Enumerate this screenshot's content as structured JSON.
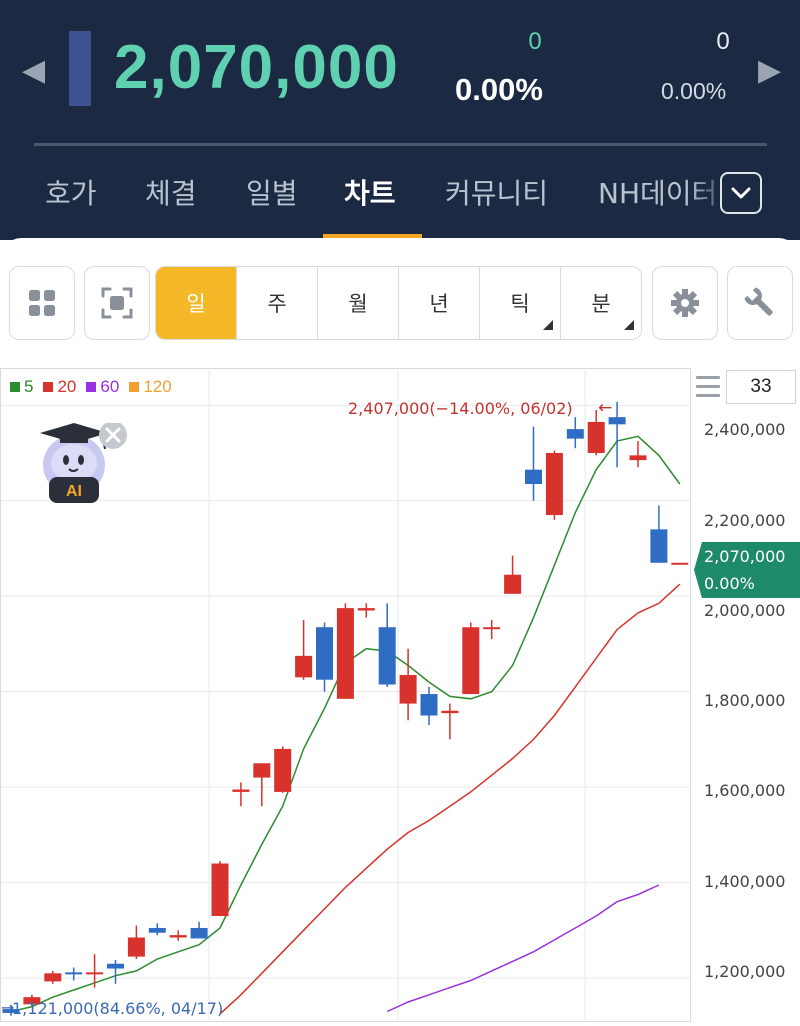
{
  "header": {
    "price": "2,070,000",
    "change_primary": "0",
    "change_primary_pct": "0.00%",
    "change_secondary": "0",
    "change_secondary_pct": "0.00%",
    "nav_left_icon": "chevron-left-icon",
    "nav_right_icon": "chevron-right-icon",
    "colors": {
      "background": "#1b2a42",
      "price": "#5fd0b0",
      "indicator": "#3f5394"
    }
  },
  "tabs": {
    "items": [
      {
        "label": "호가",
        "active": false
      },
      {
        "label": "체결",
        "active": false
      },
      {
        "label": "일별",
        "active": false
      },
      {
        "label": "차트",
        "active": true
      },
      {
        "label": "커뮤니티",
        "active": false
      },
      {
        "label": "NH데이터",
        "active": false
      }
    ],
    "more_icon": "chevron-down-icon",
    "accent": "#f5a524"
  },
  "toolbar": {
    "layout_icon": "grid-icon",
    "capture_icon": "screenshot-icon",
    "periods": [
      {
        "label": "일",
        "active": true,
        "has_dropdown": false
      },
      {
        "label": "주",
        "active": false,
        "has_dropdown": false
      },
      {
        "label": "월",
        "active": false,
        "has_dropdown": false
      },
      {
        "label": "년",
        "active": false,
        "has_dropdown": false
      },
      {
        "label": "틱",
        "active": false,
        "has_dropdown": true
      },
      {
        "label": "분",
        "active": false,
        "has_dropdown": true
      }
    ],
    "settings_icon": "gear-icon",
    "tools_icon": "wrench-icon",
    "active_color": "#f5b829"
  },
  "chart_panel": {
    "period_count": "33",
    "menu_icon": "hamburger-icon",
    "ai_badge": {
      "label": "AI",
      "close_icon": "close-icon"
    },
    "current_price": "2,070,000",
    "current_pct": "0.00%",
    "high_label": "2,407,000(−14.00%, 06/02)",
    "low_label": "1,121,000(84.66%, 04/17)"
  },
  "chart_data": {
    "type": "candlestick",
    "legend": [
      {
        "name": "5",
        "color": "#2e8b2e"
      },
      {
        "name": "20",
        "color": "#d8322c"
      },
      {
        "name": "60",
        "color": "#9b30e0"
      },
      {
        "name": "120",
        "color": "#f0a030"
      }
    ],
    "y_ticks": [
      "2,400,000",
      "2,200,000",
      "2,000,000",
      "1,800,000",
      "1,600,000",
      "1,400,000",
      "1,200,000"
    ],
    "y_tick_values": [
      2400000,
      2200000,
      2000000,
      1800000,
      1600000,
      1400000,
      1200000
    ],
    "ylim": [
      1108000,
      2478000
    ],
    "grid": true,
    "up_color": "#d8322c",
    "down_color": "#2f6cc4",
    "candles": [
      {
        "open": 1135000,
        "high": 1143000,
        "low": 1121000,
        "close": 1127000
      },
      {
        "open": 1145000,
        "high": 1165000,
        "low": 1140000,
        "close": 1160000
      },
      {
        "open": 1193000,
        "high": 1215000,
        "low": 1188000,
        "close": 1210000
      },
      {
        "open": 1212000,
        "high": 1222000,
        "low": 1195000,
        "close": 1208000
      },
      {
        "open": 1208000,
        "high": 1250000,
        "low": 1180000,
        "close": 1212000
      },
      {
        "open": 1230000,
        "high": 1238000,
        "low": 1188000,
        "close": 1220000
      },
      {
        "open": 1245000,
        "high": 1310000,
        "low": 1240000,
        "close": 1285000
      },
      {
        "open": 1305000,
        "high": 1315000,
        "low": 1290000,
        "close": 1295000
      },
      {
        "open": 1285000,
        "high": 1300000,
        "low": 1278000,
        "close": 1290000
      },
      {
        "open": 1305000,
        "high": 1318000,
        "low": 1285000,
        "close": 1283000
      },
      {
        "open": 1330000,
        "high": 1445000,
        "low": 1330000,
        "close": 1440000
      },
      {
        "open": 1590000,
        "high": 1610000,
        "low": 1560000,
        "close": 1595000
      },
      {
        "open": 1620000,
        "high": 1650000,
        "low": 1560000,
        "close": 1650000
      },
      {
        "open": 1590000,
        "high": 1685000,
        "low": 1588000,
        "close": 1680000
      },
      {
        "open": 1830000,
        "high": 1950000,
        "low": 1825000,
        "close": 1875000
      },
      {
        "open": 1935000,
        "high": 1945000,
        "low": 1800000,
        "close": 1825000
      },
      {
        "open": 1785000,
        "high": 1985000,
        "low": 1785000,
        "close": 1975000
      },
      {
        "open": 1970000,
        "high": 1985000,
        "low": 1955000,
        "close": 1975000
      },
      {
        "open": 1935000,
        "high": 1985000,
        "low": 1810000,
        "close": 1815000
      },
      {
        "open": 1775000,
        "high": 1890000,
        "low": 1740000,
        "close": 1835000
      },
      {
        "open": 1795000,
        "high": 1810000,
        "low": 1730000,
        "close": 1750000
      },
      {
        "open": 1755000,
        "high": 1775000,
        "low": 1700000,
        "close": 1760000
      },
      {
        "open": 1795000,
        "high": 1945000,
        "low": 1795000,
        "close": 1935000
      },
      {
        "open": 1935000,
        "high": 1950000,
        "low": 1910000,
        "close": 1935000
      },
      {
        "open": 2005000,
        "high": 2085000,
        "low": 2005000,
        "close": 2045000
      },
      {
        "open": 2265000,
        "high": 2355000,
        "low": 2200000,
        "close": 2235000
      },
      {
        "open": 2170000,
        "high": 2305000,
        "low": 2160000,
        "close": 2300000
      },
      {
        "open": 2350000,
        "high": 2375000,
        "low": 2310000,
        "close": 2330000
      },
      {
        "open": 2300000,
        "high": 2390000,
        "low": 2295000,
        "close": 2365000
      },
      {
        "open": 2375000,
        "high": 2407000,
        "low": 2270000,
        "close": 2360000
      },
      {
        "open": 2285000,
        "high": 2325000,
        "low": 2270000,
        "close": 2295000
      },
      {
        "open": 2140000,
        "high": 2190000,
        "low": 2070000,
        "close": 2070000
      },
      {
        "open": 2070000,
        "high": 2070000,
        "low": 2070000,
        "close": 2070000
      }
    ],
    "ma5": {
      "start_index": 0,
      "values": [
        1130000,
        1140000,
        1160000,
        1175000,
        1190000,
        1205000,
        1215000,
        1240000,
        1255000,
        1270000,
        1305000,
        1395000,
        1480000,
        1560000,
        1680000,
        1765000,
        1860000,
        1890000,
        1885000,
        1855000,
        1820000,
        1790000,
        1785000,
        1800000,
        1855000,
        1955000,
        2065000,
        2175000,
        2265000,
        2325000,
        2335000,
        2295000,
        2235000
      ]
    },
    "ma20": {
      "start_index": 10,
      "values": [
        1125000,
        1165000,
        1210000,
        1255000,
        1300000,
        1345000,
        1390000,
        1430000,
        1470000,
        1505000,
        1530000,
        1560000,
        1590000,
        1625000,
        1660000,
        1700000,
        1750000,
        1810000,
        1870000,
        1930000,
        1965000,
        1985000,
        2025000
      ]
    },
    "ma60": {
      "start_index": 18,
      "values": [
        1130000,
        1150000,
        1165000,
        1180000,
        1195000,
        1215000,
        1235000,
        1255000,
        1280000,
        1305000,
        1330000,
        1360000,
        1375000,
        1395000
      ]
    }
  }
}
